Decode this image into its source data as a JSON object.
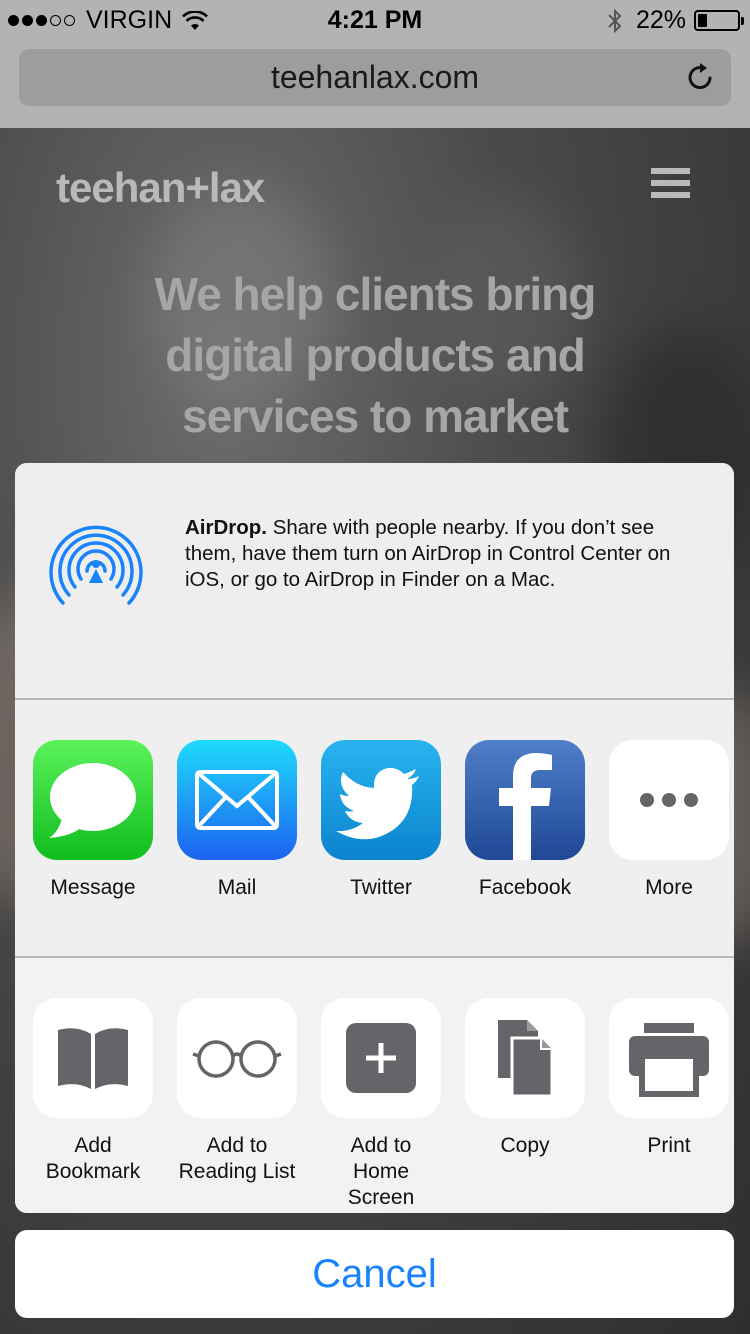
{
  "status_bar": {
    "carrier": "VIRGIN",
    "time": "4:21 PM",
    "battery": "22%",
    "battery_level": 0.22,
    "signal_bars_filled": 3,
    "signal_bars_total": 5
  },
  "browser": {
    "url": "teehanlax.com",
    "reload_icon": "reload-icon"
  },
  "page": {
    "logo": "teehan+lax",
    "menu_icon": "hamburger-menu-icon",
    "hero_line1": "We help clients bring",
    "hero_line2": "digital products and",
    "hero_line3": "services to market"
  },
  "airdrop": {
    "title": "AirDrop.",
    "description": "Share with people nearby. If you don’t see them, have them turn on AirDrop in Control Center on iOS, or go to AirDrop in Finder on a Mac.",
    "icon": "airdrop-icon",
    "color": "#1a82fb"
  },
  "share_apps": [
    {
      "label": "Message",
      "icon": "message-icon"
    },
    {
      "label": "Mail",
      "icon": "mail-icon"
    },
    {
      "label": "Twitter",
      "icon": "twitter-icon"
    },
    {
      "label": "Facebook",
      "icon": "facebook-icon"
    },
    {
      "label": "More",
      "icon": "more-icon"
    }
  ],
  "actions": [
    {
      "line1": "Add",
      "line2": "Bookmark",
      "icon": "bookmark-icon"
    },
    {
      "line1": "Add to",
      "line2": "Reading List",
      "icon": "reading-list-icon"
    },
    {
      "line1": "Add to",
      "line2": "Home Screen",
      "icon": "add-home-screen-icon"
    },
    {
      "line1": "Copy",
      "line2": "",
      "icon": "copy-icon"
    },
    {
      "line1": "Print",
      "line2": "",
      "icon": "print-icon"
    }
  ],
  "cancel": "Cancel",
  "colors": {
    "accent": "#1a82fb",
    "action_glyph": "#646469"
  }
}
